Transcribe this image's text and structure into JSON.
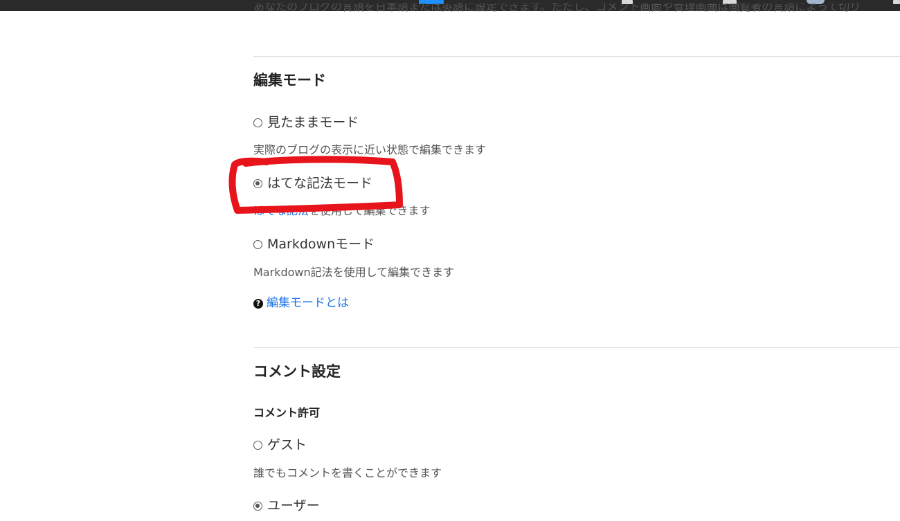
{
  "language_section": {
    "description": "あなたのブログの言語を日本語または英語に設定できます。ただし、コメント画面や管理画面は閲覧者の言語によって切り"
  },
  "edit_mode": {
    "heading": "編集モード",
    "options": [
      {
        "label": "見たままモード",
        "selected": false,
        "description": "実際のブログの表示に近い状態で編集できます"
      },
      {
        "label": "はてな記法モード",
        "selected": true,
        "description_link": "はてな記法",
        "description_rest": "を使用して編集できます"
      },
      {
        "label": "Markdownモード",
        "selected": false,
        "description": "Markdown記法を使用して編集できます"
      }
    ],
    "help_link": "編集モードとは",
    "help_icon": "question-circle-icon"
  },
  "comment_settings": {
    "heading": "コメント設定",
    "subheading": "コメント許可",
    "options": [
      {
        "label": "ゲスト",
        "selected": false,
        "description": "誰でもコメントを書くことができます"
      },
      {
        "label": "ユーザー",
        "selected": true
      }
    ]
  },
  "annotation": {
    "color": "#e8141c",
    "shape": "hand-drawn-rectangle"
  },
  "colors": {
    "link": "#1a73e8",
    "topbar": "#2a2a2a"
  }
}
